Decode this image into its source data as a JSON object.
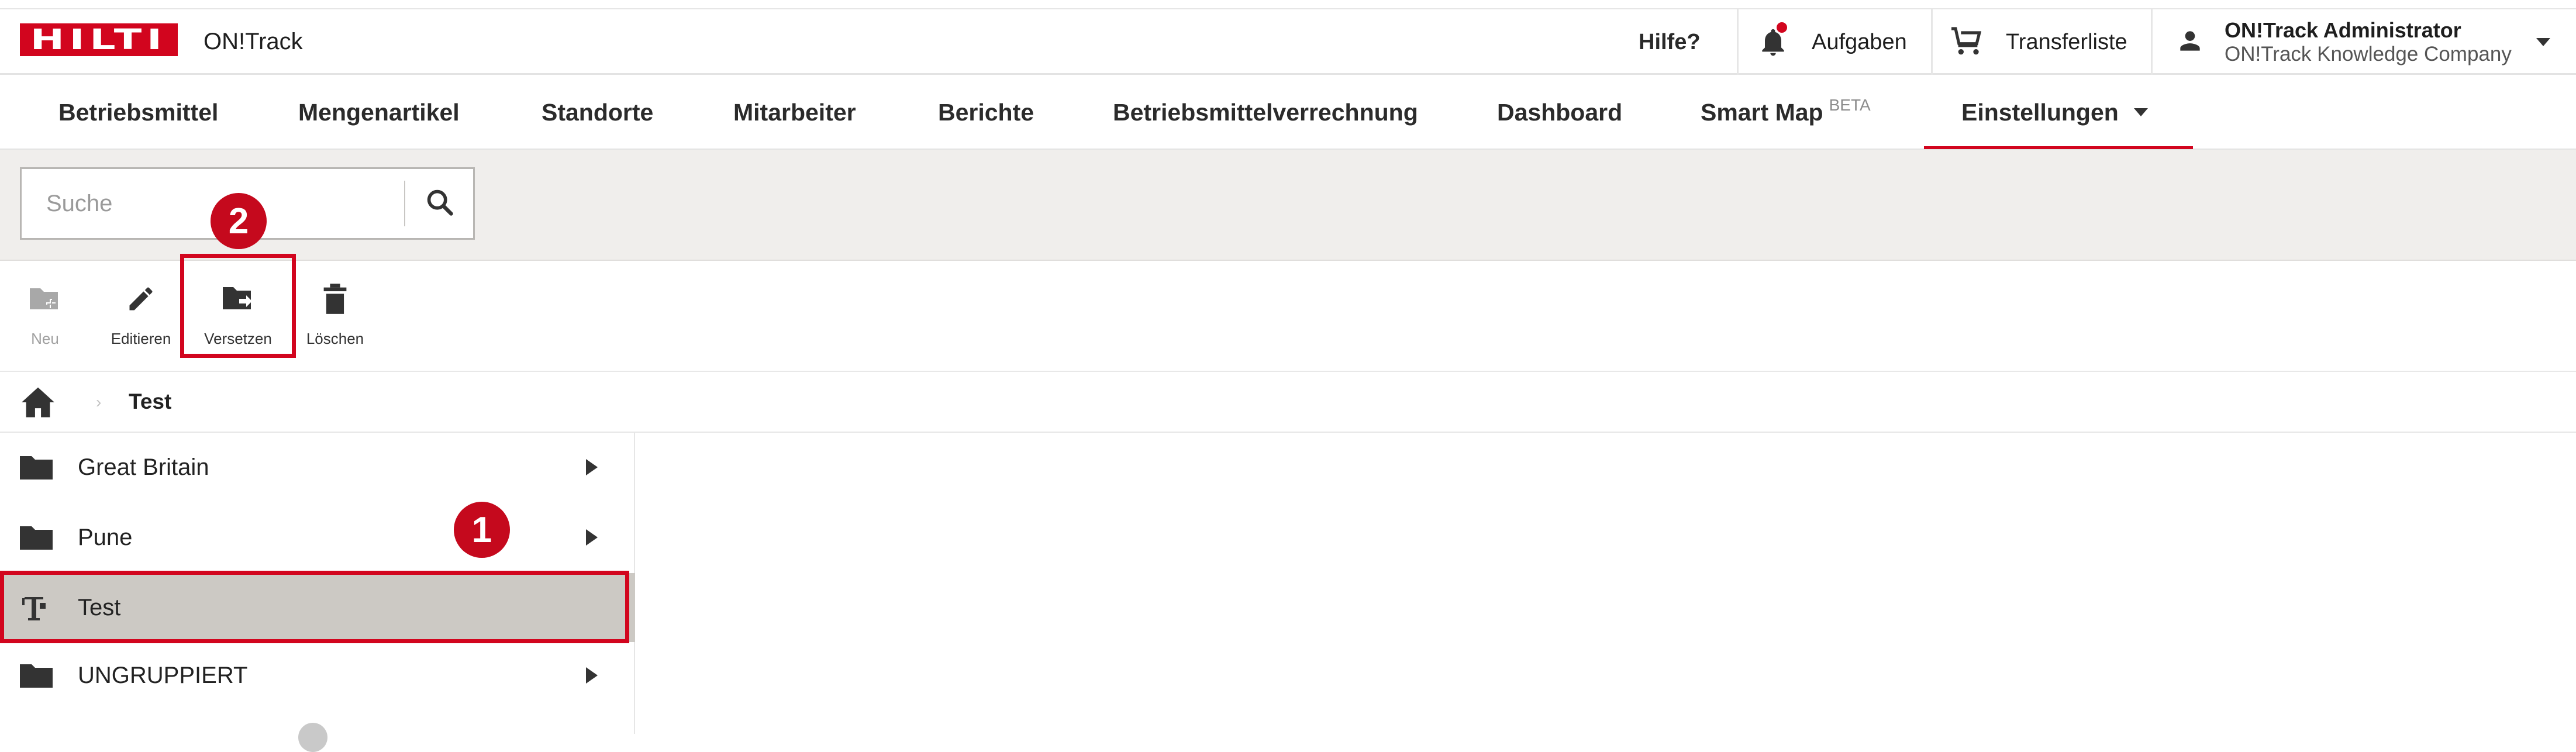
{
  "header": {
    "logo_text": "HILTI",
    "app_name": "ON!Track",
    "help_label": "Hilfe?",
    "tasks_label": "Aufgaben",
    "transfer_label": "Transferliste",
    "user_name": "ON!Track Administrator",
    "user_company": "ON!Track Knowledge Company"
  },
  "nav": {
    "items": [
      {
        "label": "Betriebsmittel"
      },
      {
        "label": "Mengenartikel"
      },
      {
        "label": "Standorte"
      },
      {
        "label": "Mitarbeiter"
      },
      {
        "label": "Berichte"
      },
      {
        "label": "Betriebsmittelverrechnung"
      },
      {
        "label": "Dashboard"
      },
      {
        "label": "Smart Map",
        "badge": "BETA"
      },
      {
        "label": "Einstellungen",
        "active": true
      }
    ]
  },
  "search": {
    "placeholder": "Suche",
    "value": ""
  },
  "toolbar": {
    "new_label": "Neu",
    "edit_label": "Editieren",
    "move_label": "Versetzen",
    "delete_label": "Löschen"
  },
  "callouts": {
    "step1": "1",
    "step2": "2"
  },
  "breadcrumb": {
    "current": "Test"
  },
  "tree": {
    "items": [
      {
        "label": "Great Britain",
        "icon": "folder-icon",
        "expandable": true
      },
      {
        "label": "Pune",
        "icon": "folder-icon",
        "expandable": true
      },
      {
        "label": "Test",
        "icon": "construction-site-icon",
        "expandable": false,
        "selected": true
      },
      {
        "label": "UNGRUPPIERT",
        "icon": "folder-icon",
        "expandable": true
      }
    ]
  },
  "colors": {
    "brand_red": "#d2051e",
    "search_band": "#f0eeec",
    "selected_row": "#ccc9c4"
  }
}
